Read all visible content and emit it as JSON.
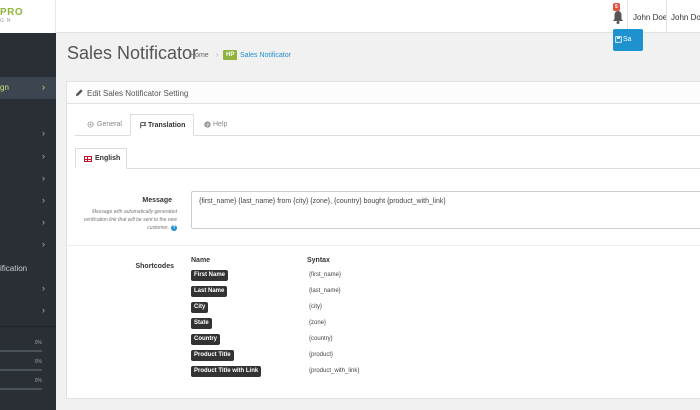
{
  "header": {
    "logo": "PRO",
    "logo_sub": "GN",
    "notification_count": "5",
    "user_name_1": "John Doe",
    "user_name_2": "John Doe"
  },
  "sidebar": {
    "items": [
      {
        "label": "gn",
        "active": true
      },
      {
        "label": ""
      },
      {
        "label": ""
      },
      {
        "label": ""
      },
      {
        "label": ""
      },
      {
        "label": ""
      },
      {
        "label": ""
      },
      {
        "label": "ification"
      },
      {
        "label": ""
      },
      {
        "label": ""
      }
    ],
    "progress": [
      {
        "percent": "0%"
      },
      {
        "percent": "0%"
      },
      {
        "percent": "0%"
      }
    ]
  },
  "page": {
    "title": "Sales Notificator",
    "breadcrumb": {
      "home": "Home",
      "badge": "HP",
      "current": "Sales Notificator"
    }
  },
  "panel": {
    "title": "Edit Sales Notificator Setting",
    "save_label": "Sa",
    "tabs": [
      {
        "label": "General"
      },
      {
        "label": "Translation",
        "active": true
      },
      {
        "label": "Help"
      }
    ],
    "language_tab": "English",
    "message": {
      "label": "Message",
      "help": "Message with automatically generated verification link that will be sent to the new customer.",
      "value": "{first_name} {last_name} from {city} {zone}, {country} bought {product_with_link}"
    },
    "shortcodes": {
      "label": "Shortcodes",
      "col_name": "Name",
      "col_syntax": "Syntax",
      "rows": [
        {
          "name": "First Name",
          "syntax": "{first_name}"
        },
        {
          "name": "Last Name",
          "syntax": "{last_name}"
        },
        {
          "name": "City",
          "syntax": "{city}"
        },
        {
          "name": "State",
          "syntax": "{zone}"
        },
        {
          "name": "Country",
          "syntax": "{country}"
        },
        {
          "name": "Product Title",
          "syntax": "{product}"
        },
        {
          "name": "Product Title with Link",
          "syntax": "{product_with_link}"
        }
      ]
    }
  }
}
